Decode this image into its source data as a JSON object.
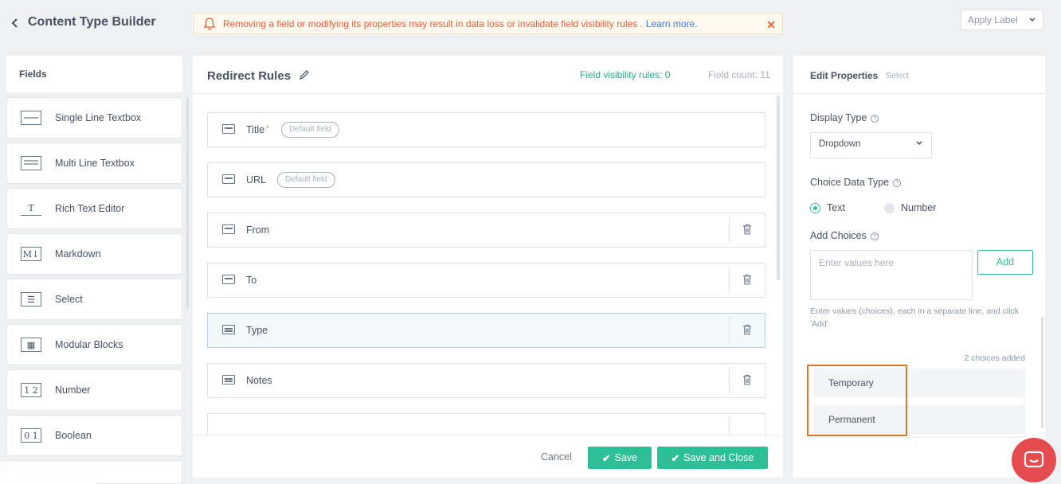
{
  "header": {
    "title": "Content Type Builder",
    "alert_message": "Removing a field or modifying its properties may result in data loss or invalidate field visibility rules .",
    "alert_link": "Learn more.",
    "apply_label": "Apply Label"
  },
  "fields_panel": {
    "title": "Fields",
    "items": [
      {
        "label": "Single Line Textbox",
        "icon": "single-line-icon",
        "glyph": ""
      },
      {
        "label": "Multi Line Textbox",
        "icon": "multi-line-icon",
        "glyph": ""
      },
      {
        "label": "Rich Text Editor",
        "icon": "rich-text-icon",
        "glyph": "T"
      },
      {
        "label": "Markdown",
        "icon": "markdown-icon",
        "glyph": "M↓"
      },
      {
        "label": "Select",
        "icon": "select-icon",
        "glyph": "☰"
      },
      {
        "label": "Modular Blocks",
        "icon": "modular-blocks-icon",
        "glyph": "▦"
      },
      {
        "label": "Number",
        "icon": "number-icon",
        "glyph": "1 2"
      },
      {
        "label": "Boolean",
        "icon": "boolean-icon",
        "glyph": "0 1"
      }
    ]
  },
  "main": {
    "content_type_name": "Redirect Rules",
    "visibility_rules": "Field visibility rules: 0",
    "field_count": "Field count: 11",
    "rows": [
      {
        "label": "Title",
        "required": "*",
        "badge": "Default field"
      },
      {
        "label": "URL",
        "badge": "Default field"
      },
      {
        "label": "From"
      },
      {
        "label": "To"
      },
      {
        "label": "Type"
      },
      {
        "label": "Notes"
      }
    ],
    "cancel": "Cancel",
    "save": "Save",
    "save_close": "Save and Close"
  },
  "properties": {
    "title": "Edit Properties",
    "subtitle": "Select",
    "display_type_label": "Display Type",
    "display_type_value": "Dropdown",
    "choice_data_type_label": "Choice Data Type",
    "radio_text": "Text",
    "radio_number": "Number",
    "add_choices_label": "Add Choices",
    "input_placeholder": "Enter values here",
    "add_button": "Add",
    "hint": "Enter values (choices), each in a separate line, and click 'Add'.",
    "choices_count": "2 choices added",
    "choices": [
      "Temporary",
      "Permanent"
    ]
  },
  "colors": {
    "accent": "#2ebf98",
    "alert_text": "#e2603c",
    "highlight": "#d9782d",
    "chat": "#e54c4f"
  }
}
